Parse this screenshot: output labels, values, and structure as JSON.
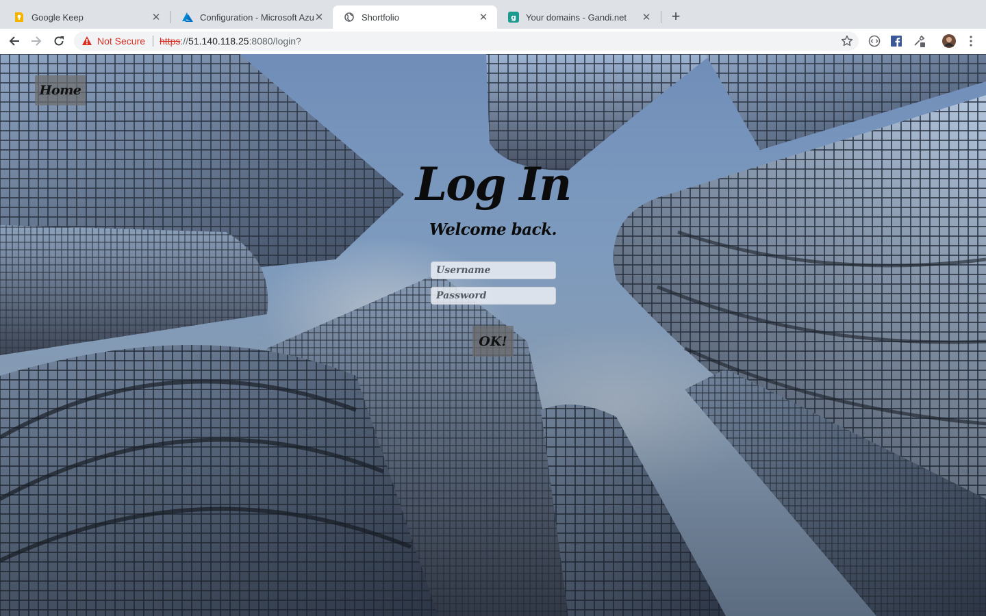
{
  "browser": {
    "tabs": [
      {
        "title": "Google Keep",
        "favicon": "google-keep-icon",
        "active": false
      },
      {
        "title": "Configuration - Microsoft Azure",
        "favicon": "azure-icon",
        "active": false
      },
      {
        "title": "Shortfolio",
        "favicon": "globe-icon",
        "active": true
      },
      {
        "title": "Your domains - Gandi.net",
        "favicon": "gandi-icon",
        "active": false
      }
    ],
    "security_label": "Not Secure",
    "url_scheme": "https",
    "url_sep": "://",
    "url_host": "51.140.118.25",
    "url_rest": ":8080/login?",
    "colors": {
      "tab_strip": "#dee1e6",
      "warning": "#d93025",
      "omnibox": "#f1f3f4"
    }
  },
  "page": {
    "home_label": "Home",
    "title": "Log In",
    "subtitle": "Welcome back.",
    "username_placeholder": "Username",
    "password_placeholder": "Password",
    "submit_label": "OK!"
  }
}
